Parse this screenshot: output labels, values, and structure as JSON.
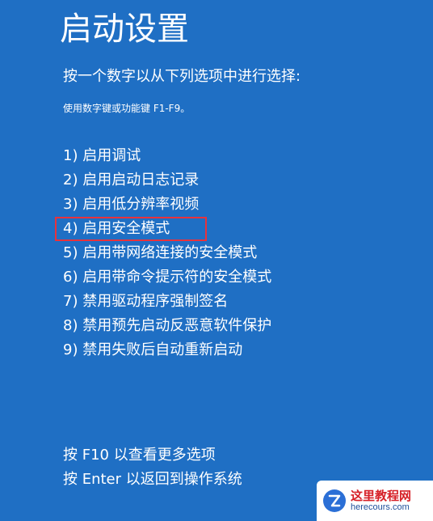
{
  "header": {
    "title": "启动设置",
    "subtitle": "按一个数字以从下列选项中进行选择:",
    "hint": "使用数字键或功能键 F1-F9。"
  },
  "options": [
    {
      "label": "1) 启用调试"
    },
    {
      "label": "2) 启用启动日志记录"
    },
    {
      "label": "3) 启用低分辨率视频"
    },
    {
      "label": "4) 启用安全模式",
      "highlighted": true
    },
    {
      "label": "5) 启用带网络连接的安全模式"
    },
    {
      "label": "6) 启用带命令提示符的安全模式"
    },
    {
      "label": "7) 禁用驱动程序强制签名"
    },
    {
      "label": "8) 禁用预先启动反恶意软件保护"
    },
    {
      "label": "9) 禁用失败后自动重新启动"
    }
  ],
  "footer": {
    "more_options": "按 F10 以查看更多选项",
    "return_os": "按 Enter 以返回到操作系统"
  },
  "watermark": {
    "name": "这里教程网",
    "url": "herecours.com"
  },
  "colors": {
    "background": "#1f6fc4",
    "text": "#ffffff",
    "highlight_border": "#e8323c"
  }
}
